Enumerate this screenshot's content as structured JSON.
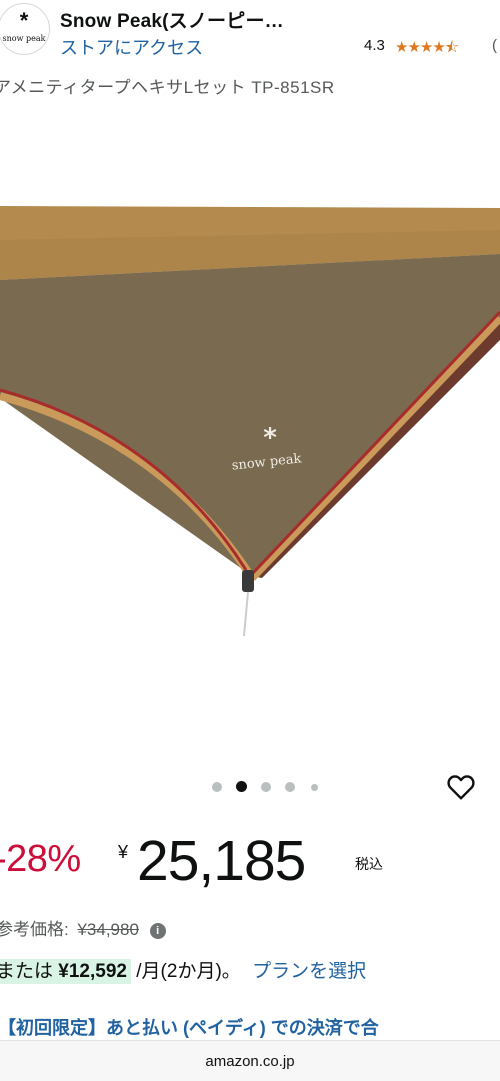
{
  "store": {
    "logo_symbol": "*",
    "logo_text": "snow peak",
    "name": "Snow Peak(スノーピー…",
    "link": "ストアにアクセス",
    "rating": "4.3",
    "rating_stars": 4.3,
    "rating_paren": "("
  },
  "product": {
    "title": "アメニティタープヘキサLセット TP-851SR",
    "image_brand": "snow peak",
    "image_count": 5,
    "active_image_index": 1
  },
  "pricing": {
    "discount": "-28%",
    "currency_symbol": "¥",
    "price": "25,185",
    "tax_label": "税込",
    "ref_label": "参考価格:",
    "ref_price": "¥34,980",
    "info_glyph": "i",
    "install_prefix": "または",
    "install_amount": "¥12,592",
    "install_suffix": "/月(2か月)。",
    "plan_link": "プランを選択"
  },
  "promo": {
    "text": "【初回限定】あと払い (ペイディ) での決済で合"
  },
  "browser": {
    "domain": "amazon.co.jp"
  },
  "colors": {
    "link": "#2162a1",
    "discount": "#cc0c39",
    "star": "#de7921",
    "tarp_main": "#7a6a50",
    "tarp_top": "#b48a4e",
    "tarp_edge": "#a82c2c",
    "install_highlight": "#d9f3e5"
  },
  "icons": {
    "wishlist": "heart-outline-icon",
    "info": "info-circle-icon"
  }
}
